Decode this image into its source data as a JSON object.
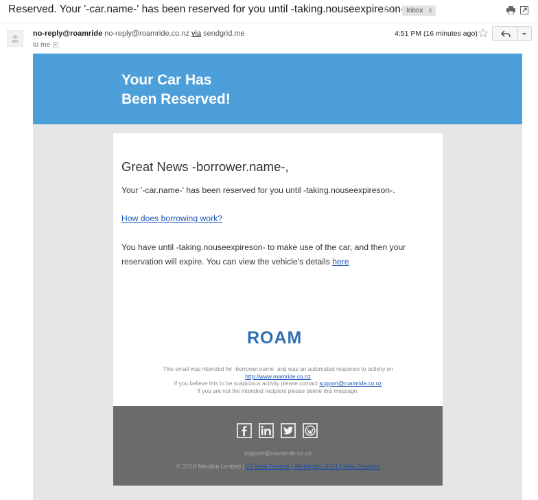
{
  "subject": "Reserved. Your '-car.name-' has been reserved for you until -taking.nouseexpireson-.",
  "label": {
    "text": "Inbox",
    "remove": "x"
  },
  "sender": {
    "name": "no-reply@roamride",
    "email": "no-reply@roamride.co.nz",
    "via_word": "via",
    "via_domain": "sendgrid.me",
    "to": "to me",
    "time": "4:51 PM (16 minutes ago)"
  },
  "icons": [
    "print-icon",
    "new-window-icon",
    "star-icon",
    "reply-icon",
    "more-icon",
    "avatar",
    "facebook-icon",
    "linkedin-icon",
    "twitter-icon",
    "wordpress-icon"
  ],
  "colors": {
    "hero": "#4d9fd9",
    "footer": "#6b6b6b",
    "link": "#1a56b6",
    "logo": "#2f6fb3",
    "logo_pin": "#e53935"
  },
  "email": {
    "hero_line1": "Your Car Has",
    "hero_line2": "Been Reserved!",
    "greeting": "Great News -borrower.name-,",
    "para1": "Your '-car.name-' has been reserved for you until -taking.nouseexpireson-.",
    "link": "How does borrowing work?",
    "para2": "You have until -taking.nouseexpireson- to make use of the car, and then your reservation will expire. You can view the vehicle's details",
    "here_link": "here",
    "logo_text": "ROAM",
    "note1": "This email was intended for -borrower.name- and was an automated response to activity on",
    "note_url": "http://www.roamride.co.nz",
    "note2": "If you believe this to be suspicious activity please contact",
    "note_support": "support@roamride.co.nz",
    "note3": "If you are not the intended recipient please delete this message."
  },
  "footer": {
    "email": "support@roamride.co.nz",
    "copyright": "© 2018 Mindkin Limited |",
    "address": "22 Kent Terrace | Wellington 6011 | New Zealand"
  }
}
